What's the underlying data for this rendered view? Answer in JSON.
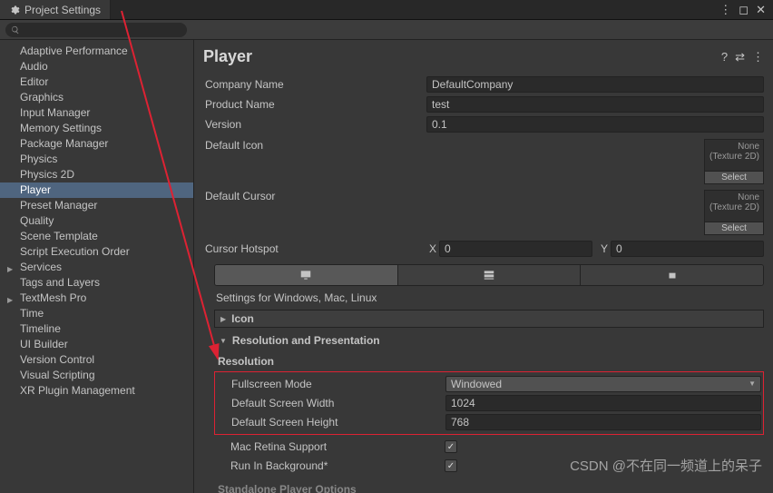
{
  "window": {
    "title": "Project Settings"
  },
  "sidebar": {
    "items": [
      {
        "label": "Adaptive Performance",
        "sel": false
      },
      {
        "label": "Audio",
        "sel": false
      },
      {
        "label": "Editor",
        "sel": false
      },
      {
        "label": "Graphics",
        "sel": false
      },
      {
        "label": "Input Manager",
        "sel": false
      },
      {
        "label": "Memory Settings",
        "sel": false
      },
      {
        "label": "Package Manager",
        "sel": false
      },
      {
        "label": "Physics",
        "sel": false
      },
      {
        "label": "Physics 2D",
        "sel": false
      },
      {
        "label": "Player",
        "sel": true
      },
      {
        "label": "Preset Manager",
        "sel": false
      },
      {
        "label": "Quality",
        "sel": false
      },
      {
        "label": "Scene Template",
        "sel": false
      },
      {
        "label": "Script Execution Order",
        "sel": false
      },
      {
        "label": "Services",
        "sel": false,
        "arrow": true
      },
      {
        "label": "Tags and Layers",
        "sel": false
      },
      {
        "label": "TextMesh Pro",
        "sel": false,
        "arrow": true
      },
      {
        "label": "Time",
        "sel": false
      },
      {
        "label": "Timeline",
        "sel": false
      },
      {
        "label": "UI Builder",
        "sel": false
      },
      {
        "label": "Version Control",
        "sel": false
      },
      {
        "label": "Visual Scripting",
        "sel": false
      },
      {
        "label": "XR Plugin Management",
        "sel": false
      }
    ]
  },
  "main": {
    "title": "Player",
    "company_label": "Company Name",
    "company_value": "DefaultCompany",
    "product_label": "Product Name",
    "product_value": "test",
    "version_label": "Version",
    "version_value": "0.1",
    "defaulticon_label": "Default Icon",
    "defaultcursor_label": "Default Cursor",
    "iconbox": {
      "none": "None",
      "type": "(Texture 2D)",
      "select": "Select"
    },
    "hotspot_label": "Cursor Hotspot",
    "hotspot_x_label": "X",
    "hotspot_x": "0",
    "hotspot_y_label": "Y",
    "hotspot_y": "0",
    "platform_caption": "Settings for Windows, Mac, Linux",
    "fold_icon": "Icon",
    "fold_res": "Resolution and Presentation",
    "res_section": "Resolution",
    "fullscreen_label": "Fullscreen Mode",
    "fullscreen_value": "Windowed",
    "width_label": "Default Screen Width",
    "width_value": "1024",
    "height_label": "Default Screen Height",
    "height_value": "768",
    "retina_label": "Mac Retina Support",
    "runbg_label": "Run In Background*",
    "footer": "Standalone Player Options"
  },
  "watermark": "CSDN @不在同一频道上的呆子"
}
